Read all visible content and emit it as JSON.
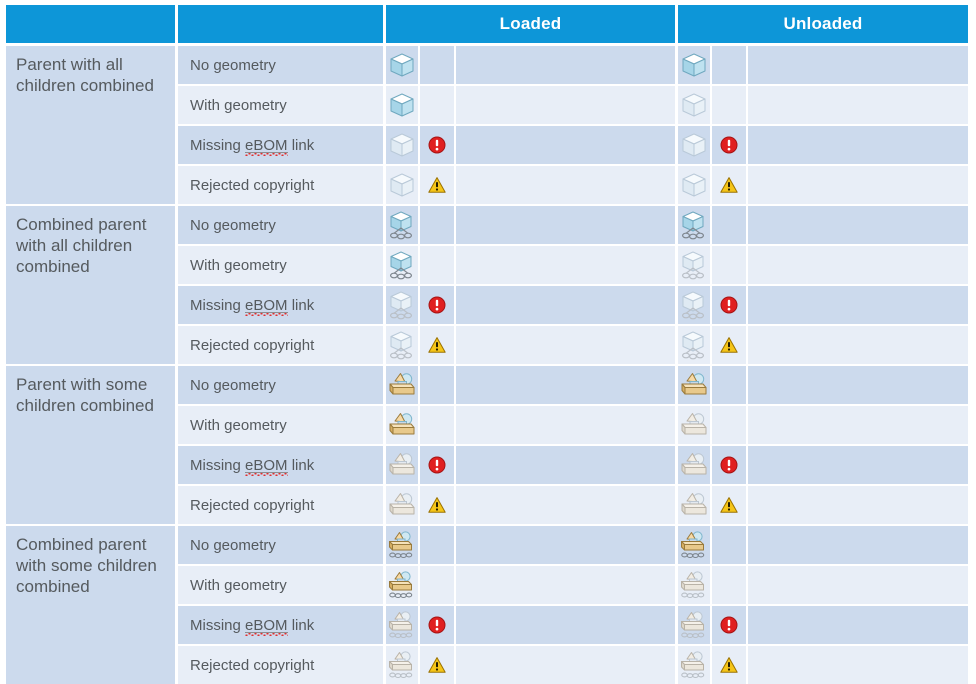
{
  "header": {
    "col_group": "",
    "col_state": "",
    "loaded": "Loaded",
    "unloaded": "Unloaded"
  },
  "colors": {
    "header_blue": "#0d96d8",
    "row_dark": "#ccdaed",
    "row_light": "#e8eef7",
    "text": "#555a5e",
    "error_red": "#e02020",
    "warning_yellow": "#f5c518",
    "grid_white": "#ffffff"
  },
  "row_labels": {
    "no_geometry": "No geometry",
    "with_geometry": "With geometry",
    "missing_prefix": "Missing ",
    "missing_term": "eBOM",
    "missing_suffix": " link",
    "rejected_copyright": "Rejected copyright"
  },
  "groups": [
    {
      "label": "Parent with all children combined",
      "icon": "cube-icon",
      "rows": [
        {
          "label_key": "no_geometry",
          "label": "No geometry",
          "loaded_icon": "cube-icon-solid",
          "loaded_status": "",
          "unloaded_icon": "cube-icon-solid-pale",
          "unloaded_status": ""
        },
        {
          "label_key": "with_geometry",
          "label": "With geometry",
          "loaded_icon": "cube-icon-solid",
          "loaded_status": "",
          "unloaded_icon": "cube-icon-pale",
          "unloaded_status": ""
        },
        {
          "label_key": "missing_ebom",
          "label": "Missing eBOM link",
          "loaded_icon": "cube-icon-pale",
          "loaded_status": "error-icon",
          "unloaded_icon": "cube-icon-pale",
          "unloaded_status": "error-icon"
        },
        {
          "label_key": "rejected_copyright",
          "label": "Rejected copyright",
          "loaded_icon": "cube-icon-pale",
          "loaded_status": "warning-icon",
          "unloaded_icon": "cube-icon-pale",
          "unloaded_status": "warning-icon"
        }
      ]
    },
    {
      "label": "Combined parent with all children combined",
      "icon": "combined-cube-icon",
      "rows": [
        {
          "label_key": "no_geometry",
          "label": "No geometry",
          "loaded_icon": "combined-cube-icon-solid",
          "loaded_status": "",
          "unloaded_icon": "combined-cube-icon-solid-pale",
          "unloaded_status": ""
        },
        {
          "label_key": "with_geometry",
          "label": "With geometry",
          "loaded_icon": "combined-cube-icon-solid",
          "loaded_status": "",
          "unloaded_icon": "combined-cube-icon-pale",
          "unloaded_status": ""
        },
        {
          "label_key": "missing_ebom",
          "label": "Missing eBOM link",
          "loaded_icon": "combined-cube-icon-pale",
          "loaded_status": "error-icon",
          "unloaded_icon": "combined-cube-icon-pale",
          "unloaded_status": "error-icon"
        },
        {
          "label_key": "rejected_copyright",
          "label": "Rejected copyright",
          "loaded_icon": "combined-cube-icon-pale",
          "loaded_status": "warning-icon",
          "unloaded_icon": "combined-cube-icon-pale",
          "unloaded_status": "warning-icon"
        }
      ]
    },
    {
      "label": "Parent with some children combined",
      "icon": "assembly-box-icon",
      "rows": [
        {
          "label_key": "no_geometry",
          "label": "No geometry",
          "loaded_icon": "assembly-box-icon-solid",
          "loaded_status": "",
          "unloaded_icon": "assembly-box-icon-solid-pale",
          "unloaded_status": ""
        },
        {
          "label_key": "with_geometry",
          "label": "With geometry",
          "loaded_icon": "assembly-box-icon-solid",
          "loaded_status": "",
          "unloaded_icon": "assembly-box-icon-pale",
          "unloaded_status": ""
        },
        {
          "label_key": "missing_ebom",
          "label": "Missing eBOM link",
          "loaded_icon": "assembly-box-icon-pale",
          "loaded_status": "error-icon",
          "unloaded_icon": "assembly-box-icon-pale",
          "unloaded_status": "error-icon"
        },
        {
          "label_key": "rejected_copyright",
          "label": "Rejected copyright",
          "loaded_icon": "assembly-box-icon-pale",
          "loaded_status": "warning-icon",
          "unloaded_icon": "assembly-box-icon-pale",
          "unloaded_status": "warning-icon"
        }
      ]
    },
    {
      "label": "Combined parent with some children combined",
      "icon": "combined-assembly-box-icon",
      "rows": [
        {
          "label_key": "no_geometry",
          "label": "No geometry",
          "loaded_icon": "combined-assembly-box-icon-solid",
          "loaded_status": "",
          "unloaded_icon": "combined-assembly-box-icon-solid-pale",
          "unloaded_status": ""
        },
        {
          "label_key": "with_geometry",
          "label": "With geometry",
          "loaded_icon": "combined-assembly-box-icon-solid",
          "loaded_status": "",
          "unloaded_icon": "combined-assembly-box-icon-pale",
          "unloaded_status": ""
        },
        {
          "label_key": "missing_ebom",
          "label": "Missing eBOM link",
          "loaded_icon": "combined-assembly-box-icon-pale",
          "loaded_status": "error-icon",
          "unloaded_icon": "combined-assembly-box-icon-pale",
          "unloaded_status": "error-icon"
        },
        {
          "label_key": "rejected_copyright",
          "label": "Rejected copyright",
          "loaded_icon": "combined-assembly-box-icon-pale",
          "loaded_status": "warning-icon",
          "unloaded_icon": "combined-assembly-box-icon-pale",
          "unloaded_status": "warning-icon"
        }
      ]
    }
  ]
}
